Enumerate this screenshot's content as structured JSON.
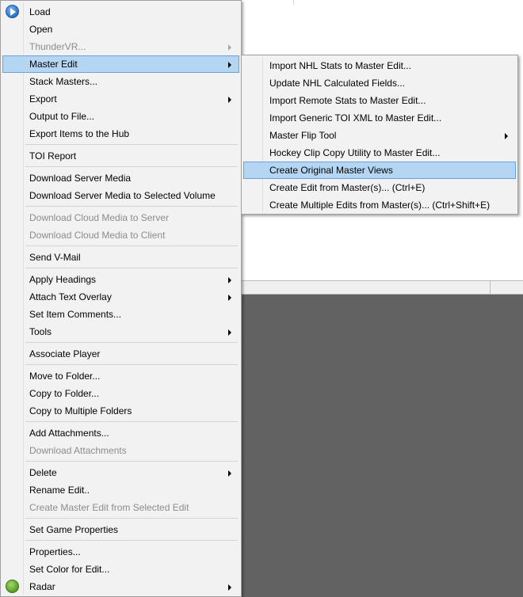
{
  "main_menu": {
    "groups": [
      [
        {
          "label": "Load",
          "icon": "play-icon",
          "disabled": false,
          "submenu": false
        },
        {
          "label": "Open",
          "disabled": false,
          "submenu": false
        },
        {
          "label": "ThunderVR...",
          "disabled": true,
          "submenu": true
        },
        {
          "label": "Master Edit",
          "disabled": false,
          "submenu": true,
          "highlighted": true
        },
        {
          "label": "Stack Masters...",
          "disabled": false,
          "submenu": false
        },
        {
          "label": "Export",
          "disabled": false,
          "submenu": true
        },
        {
          "label": "Output to File...",
          "disabled": false,
          "submenu": false
        },
        {
          "label": "Export Items to the Hub",
          "disabled": false,
          "submenu": false
        }
      ],
      [
        {
          "label": "TOI Report",
          "disabled": false,
          "submenu": false
        }
      ],
      [
        {
          "label": "Download Server Media",
          "disabled": false,
          "submenu": false
        },
        {
          "label": "Download Server Media to Selected Volume",
          "disabled": false,
          "submenu": false
        }
      ],
      [
        {
          "label": "Download Cloud Media to Server",
          "disabled": true,
          "submenu": false
        },
        {
          "label": "Download Cloud Media to Client",
          "disabled": true,
          "submenu": false
        }
      ],
      [
        {
          "label": "Send V-Mail",
          "disabled": false,
          "submenu": false
        }
      ],
      [
        {
          "label": "Apply Headings",
          "disabled": false,
          "submenu": true
        },
        {
          "label": "Attach Text Overlay",
          "disabled": false,
          "submenu": true
        },
        {
          "label": "Set Item Comments...",
          "disabled": false,
          "submenu": false
        },
        {
          "label": "Tools",
          "disabled": false,
          "submenu": true
        }
      ],
      [
        {
          "label": "Associate Player",
          "disabled": false,
          "submenu": false
        }
      ],
      [
        {
          "label": "Move to Folder...",
          "disabled": false,
          "submenu": false
        },
        {
          "label": "Copy to Folder...",
          "disabled": false,
          "submenu": false
        },
        {
          "label": "Copy to Multiple Folders",
          "disabled": false,
          "submenu": false
        }
      ],
      [
        {
          "label": "Add Attachments...",
          "disabled": false,
          "submenu": false
        },
        {
          "label": "Download Attachments",
          "disabled": true,
          "submenu": false
        }
      ],
      [
        {
          "label": "Delete",
          "disabled": false,
          "submenu": true
        },
        {
          "label": "Rename Edit..",
          "disabled": false,
          "submenu": false
        },
        {
          "label": "Create Master Edit from Selected Edit",
          "disabled": true,
          "submenu": false
        }
      ],
      [
        {
          "label": "Set Game Properties",
          "disabled": false,
          "submenu": false
        }
      ],
      [
        {
          "label": "Properties...",
          "disabled": false,
          "submenu": false
        },
        {
          "label": "Set Color for Edit...",
          "disabled": false,
          "submenu": false
        },
        {
          "label": "Radar",
          "icon": "radar-icon",
          "disabled": false,
          "submenu": true
        }
      ]
    ]
  },
  "sub_menu": {
    "items": [
      {
        "label": "Import NHL Stats to Master Edit...",
        "submenu": false
      },
      {
        "label": "Update NHL Calculated Fields...",
        "submenu": false
      },
      {
        "label": "Import Remote Stats to Master Edit...",
        "submenu": false
      },
      {
        "label": "Import Generic TOI XML to Master Edit...",
        "submenu": false
      },
      {
        "label": "Master Flip Tool",
        "submenu": true
      },
      {
        "label": "Hockey Clip Copy Utility to Master Edit...",
        "submenu": false
      },
      {
        "label": "Create Original Master Views",
        "submenu": false,
        "highlighted": true
      },
      {
        "label": "Create Edit from Master(s)... (Ctrl+E)",
        "submenu": false
      },
      {
        "label": "Create Multiple Edits from Master(s)... (Ctrl+Shift+E)",
        "submenu": false
      }
    ]
  },
  "colors": {
    "menu_bg": "#f2f2f2",
    "highlight_bg": "#b5d6f3",
    "highlight_border": "#6aa0de",
    "disabled_text": "#8c8c8c",
    "dark_panel": "#626262"
  }
}
